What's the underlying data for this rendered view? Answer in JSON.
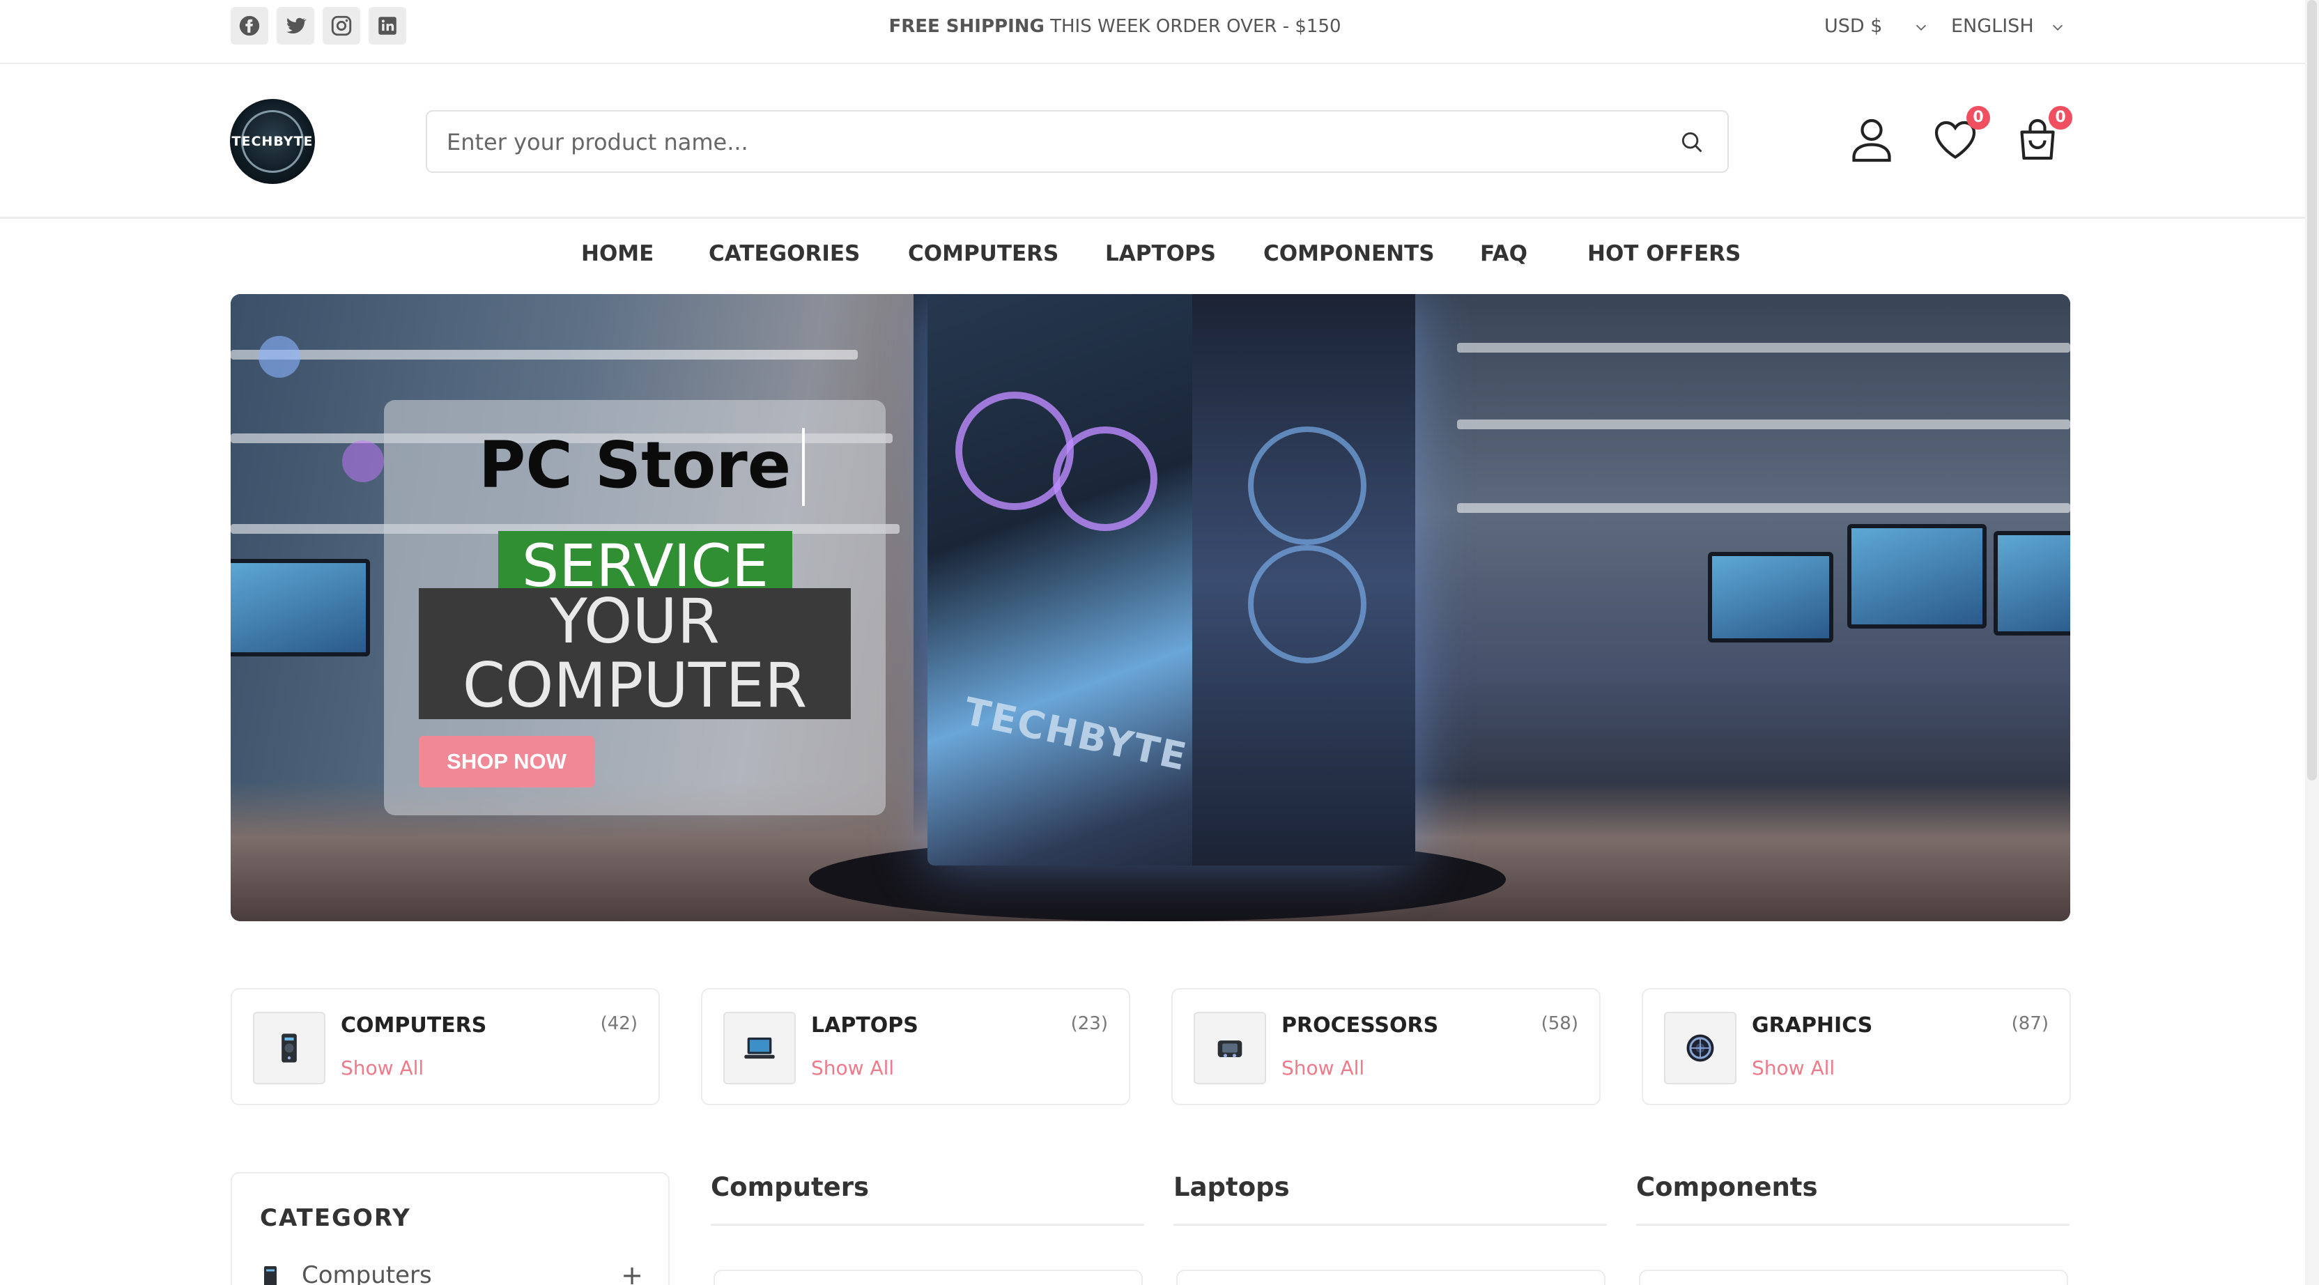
{
  "topbar": {
    "social": [
      "facebook-icon",
      "twitter-icon",
      "instagram-icon",
      "linkedin-icon"
    ],
    "promo_bold": "FREE SHIPPING",
    "promo_rest": " THIS WEEK ORDER OVER - $150",
    "currency": "USD $",
    "language": "ENGLISH"
  },
  "header": {
    "logo_text": "TECHBYTE",
    "search_placeholder": "Enter your product name...",
    "wishlist_count": "0",
    "cart_count": "0"
  },
  "nav": {
    "items": [
      "HOME",
      "CATEGORIES",
      "COMPUTERS",
      "LAPTOPS",
      "COMPONENTS",
      "FAQ",
      "HOT OFFERS"
    ]
  },
  "hero": {
    "title": "PC Store",
    "service": "SERVICE",
    "line1": "YOUR",
    "line2": "COMPUTER",
    "button": "SHOP NOW",
    "brand_on_case": "TECHBYTE"
  },
  "categories": [
    {
      "name": "COMPUTERS",
      "count": "(42)",
      "link": "Show All",
      "icon": "desktop-tower-icon"
    },
    {
      "name": "LAPTOPS",
      "count": "(23)",
      "link": "Show All",
      "icon": "laptop-icon"
    },
    {
      "name": "PROCESSORS",
      "count": "(58)",
      "link": "Show All",
      "icon": "processor-icon"
    },
    {
      "name": "GRAPHICS",
      "count": "(87)",
      "link": "Show All",
      "icon": "graphics-card-icon"
    }
  ],
  "sidebar": {
    "heading": "CATEGORY",
    "items": [
      {
        "label": "Computers",
        "toggle": "+"
      }
    ]
  },
  "columns": [
    "Computers",
    "Laptops",
    "Components"
  ],
  "colors": {
    "accent_pink": "#f08895",
    "badge_red": "#ef4f5f",
    "service_green": "#2f8f32"
  }
}
